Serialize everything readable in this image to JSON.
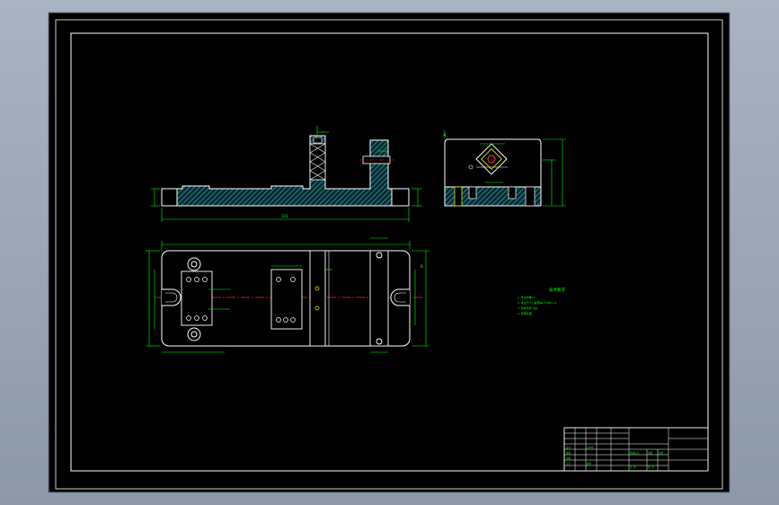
{
  "viewport": {
    "name": "cad-model-space",
    "background": "#000000",
    "backdrop": "#98a2b2"
  },
  "colors": {
    "frame": "#ffffff",
    "part": "#ffffff",
    "hatch": "#00c8c8",
    "dimension": "#00ff00",
    "centerline": "#ff2020",
    "note": "#00ff00",
    "highlight": "#ffff00"
  },
  "drawing": {
    "front_view": {
      "overall_dim": "331"
    },
    "side_view": {
      "label": "A"
    },
    "top_view": {
      "note_mark": "B"
    },
    "tech_requirements": {
      "title": "技术要求",
      "lines": [
        "1.未注倒角C1。",
        "2.未注尺寸公差按GB/T1804-m。",
        "3.去除毛刺飞边。",
        "4.调质处理。"
      ]
    },
    "title_block": {
      "cells": [
        "设计",
        "校核",
        "审核",
        "工艺",
        "标准化",
        "批准",
        "阶段标记",
        "重量",
        "比例",
        "共 张",
        "第 张"
      ]
    }
  }
}
